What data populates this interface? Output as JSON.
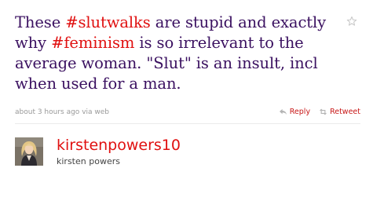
{
  "tweet": {
    "segments": [
      {
        "text": "These ",
        "hashtag": false
      },
      {
        "text": "#slutwalks",
        "hashtag": true
      },
      {
        "text": " are stupid and exactly why ",
        "hashtag": false
      },
      {
        "text": "#feminism",
        "hashtag": true
      },
      {
        "text": " is so irrelevant to the average woman. \"Slut\" is an insult, incl when used for a man.",
        "hashtag": false
      }
    ],
    "timestamp": "about 3 hours ago",
    "via": "via web"
  },
  "actions": {
    "reply_label": "Reply",
    "retweet_label": "Retweet"
  },
  "author": {
    "username": "kirstenpowers10",
    "full_name": "kirsten powers"
  },
  "colors": {
    "text": "#3a1060",
    "hashtag": "#e01010",
    "meta": "#999999"
  },
  "icons": {
    "favorite": "star-icon",
    "reply": "reply-icon",
    "retweet": "retweet-icon"
  }
}
